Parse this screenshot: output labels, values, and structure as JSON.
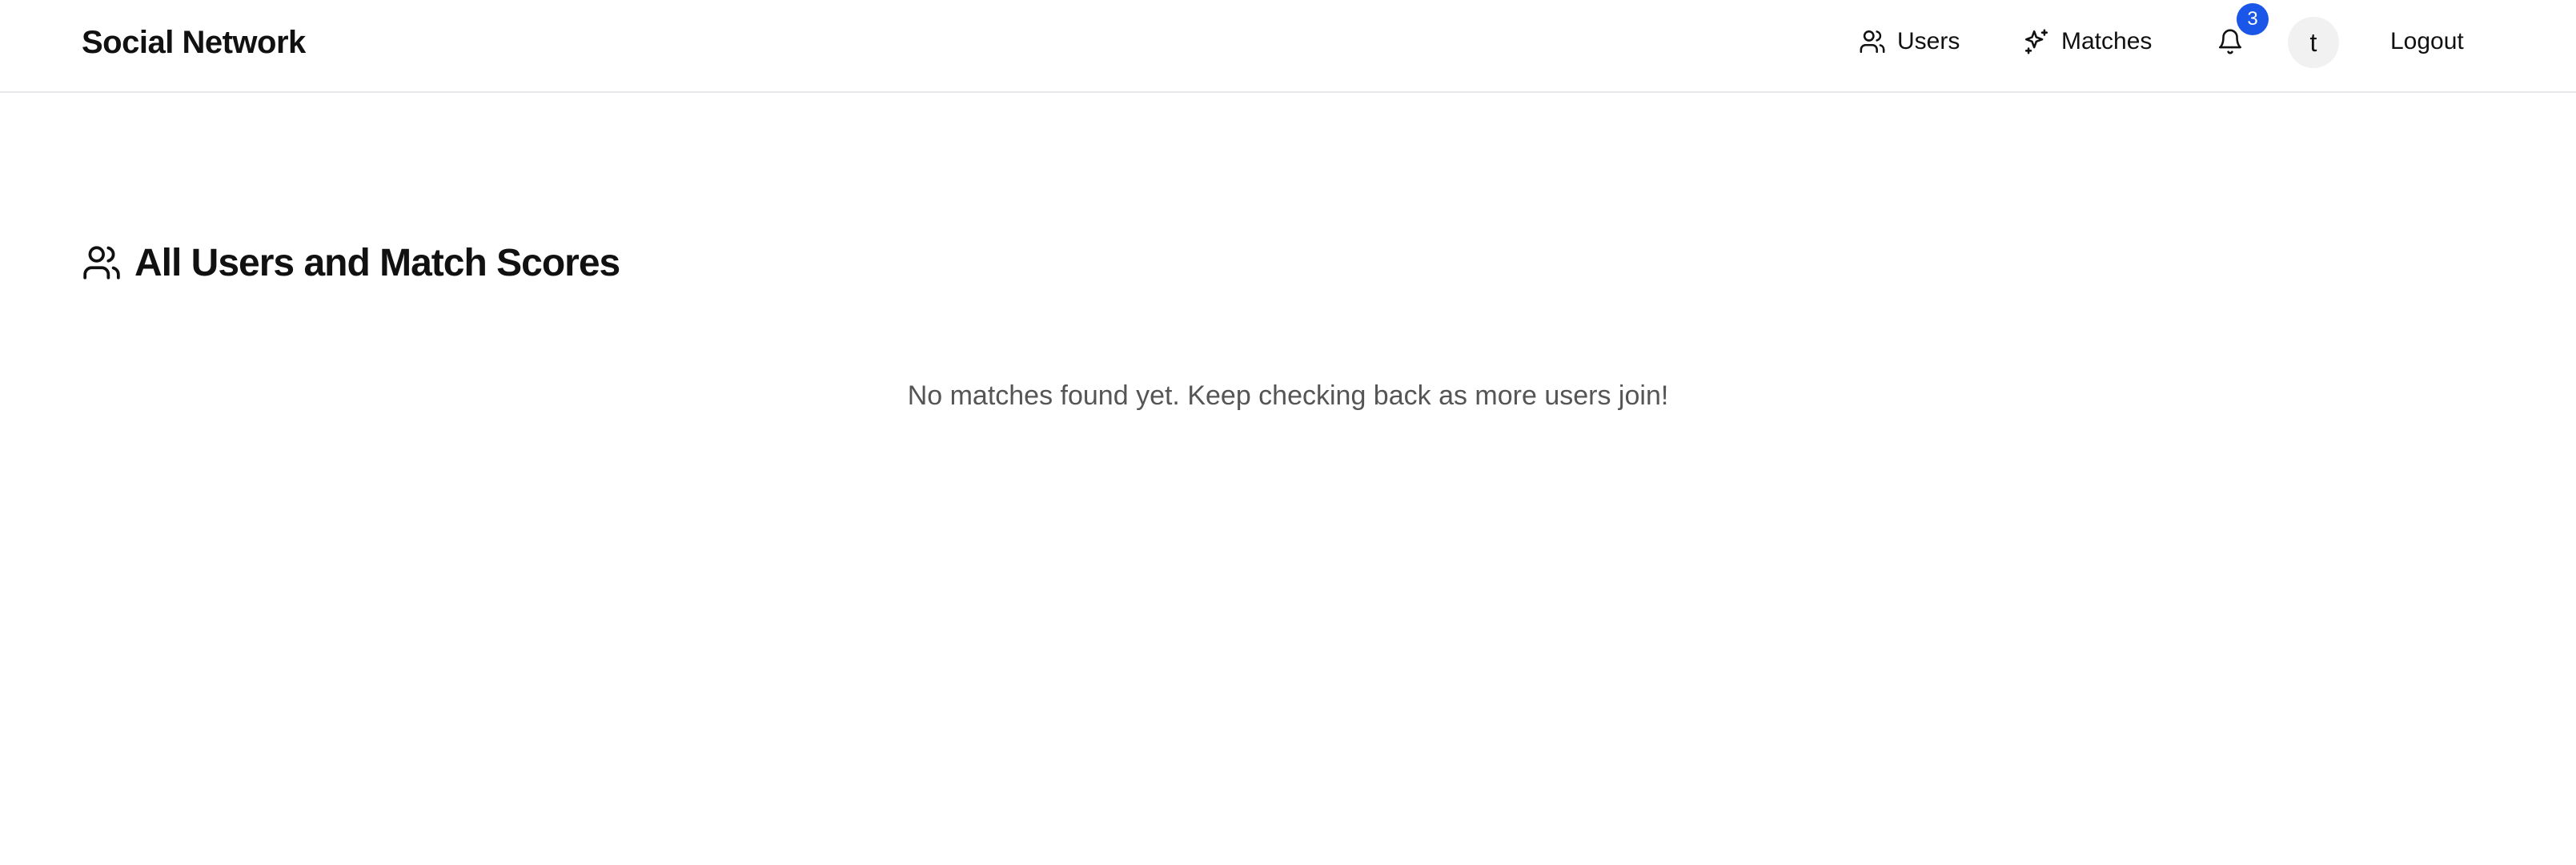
{
  "navbar": {
    "brand": "Social Network",
    "links": [
      {
        "label": "Users",
        "icon": "users-icon"
      },
      {
        "label": "Matches",
        "icon": "sparkles-icon"
      }
    ],
    "notifications": {
      "icon": "bell-icon",
      "count": "3"
    },
    "avatar_initial": "t",
    "logout_label": "Logout"
  },
  "main": {
    "title": "All Users and Match Scores",
    "title_icon": "users-icon",
    "empty_message": "No matches found yet. Keep checking back as more users join!"
  },
  "colors": {
    "badge": "#1a56e8",
    "border": "#e5e7eb",
    "muted_text": "#555555",
    "avatar_bg": "#f1f1f1"
  }
}
